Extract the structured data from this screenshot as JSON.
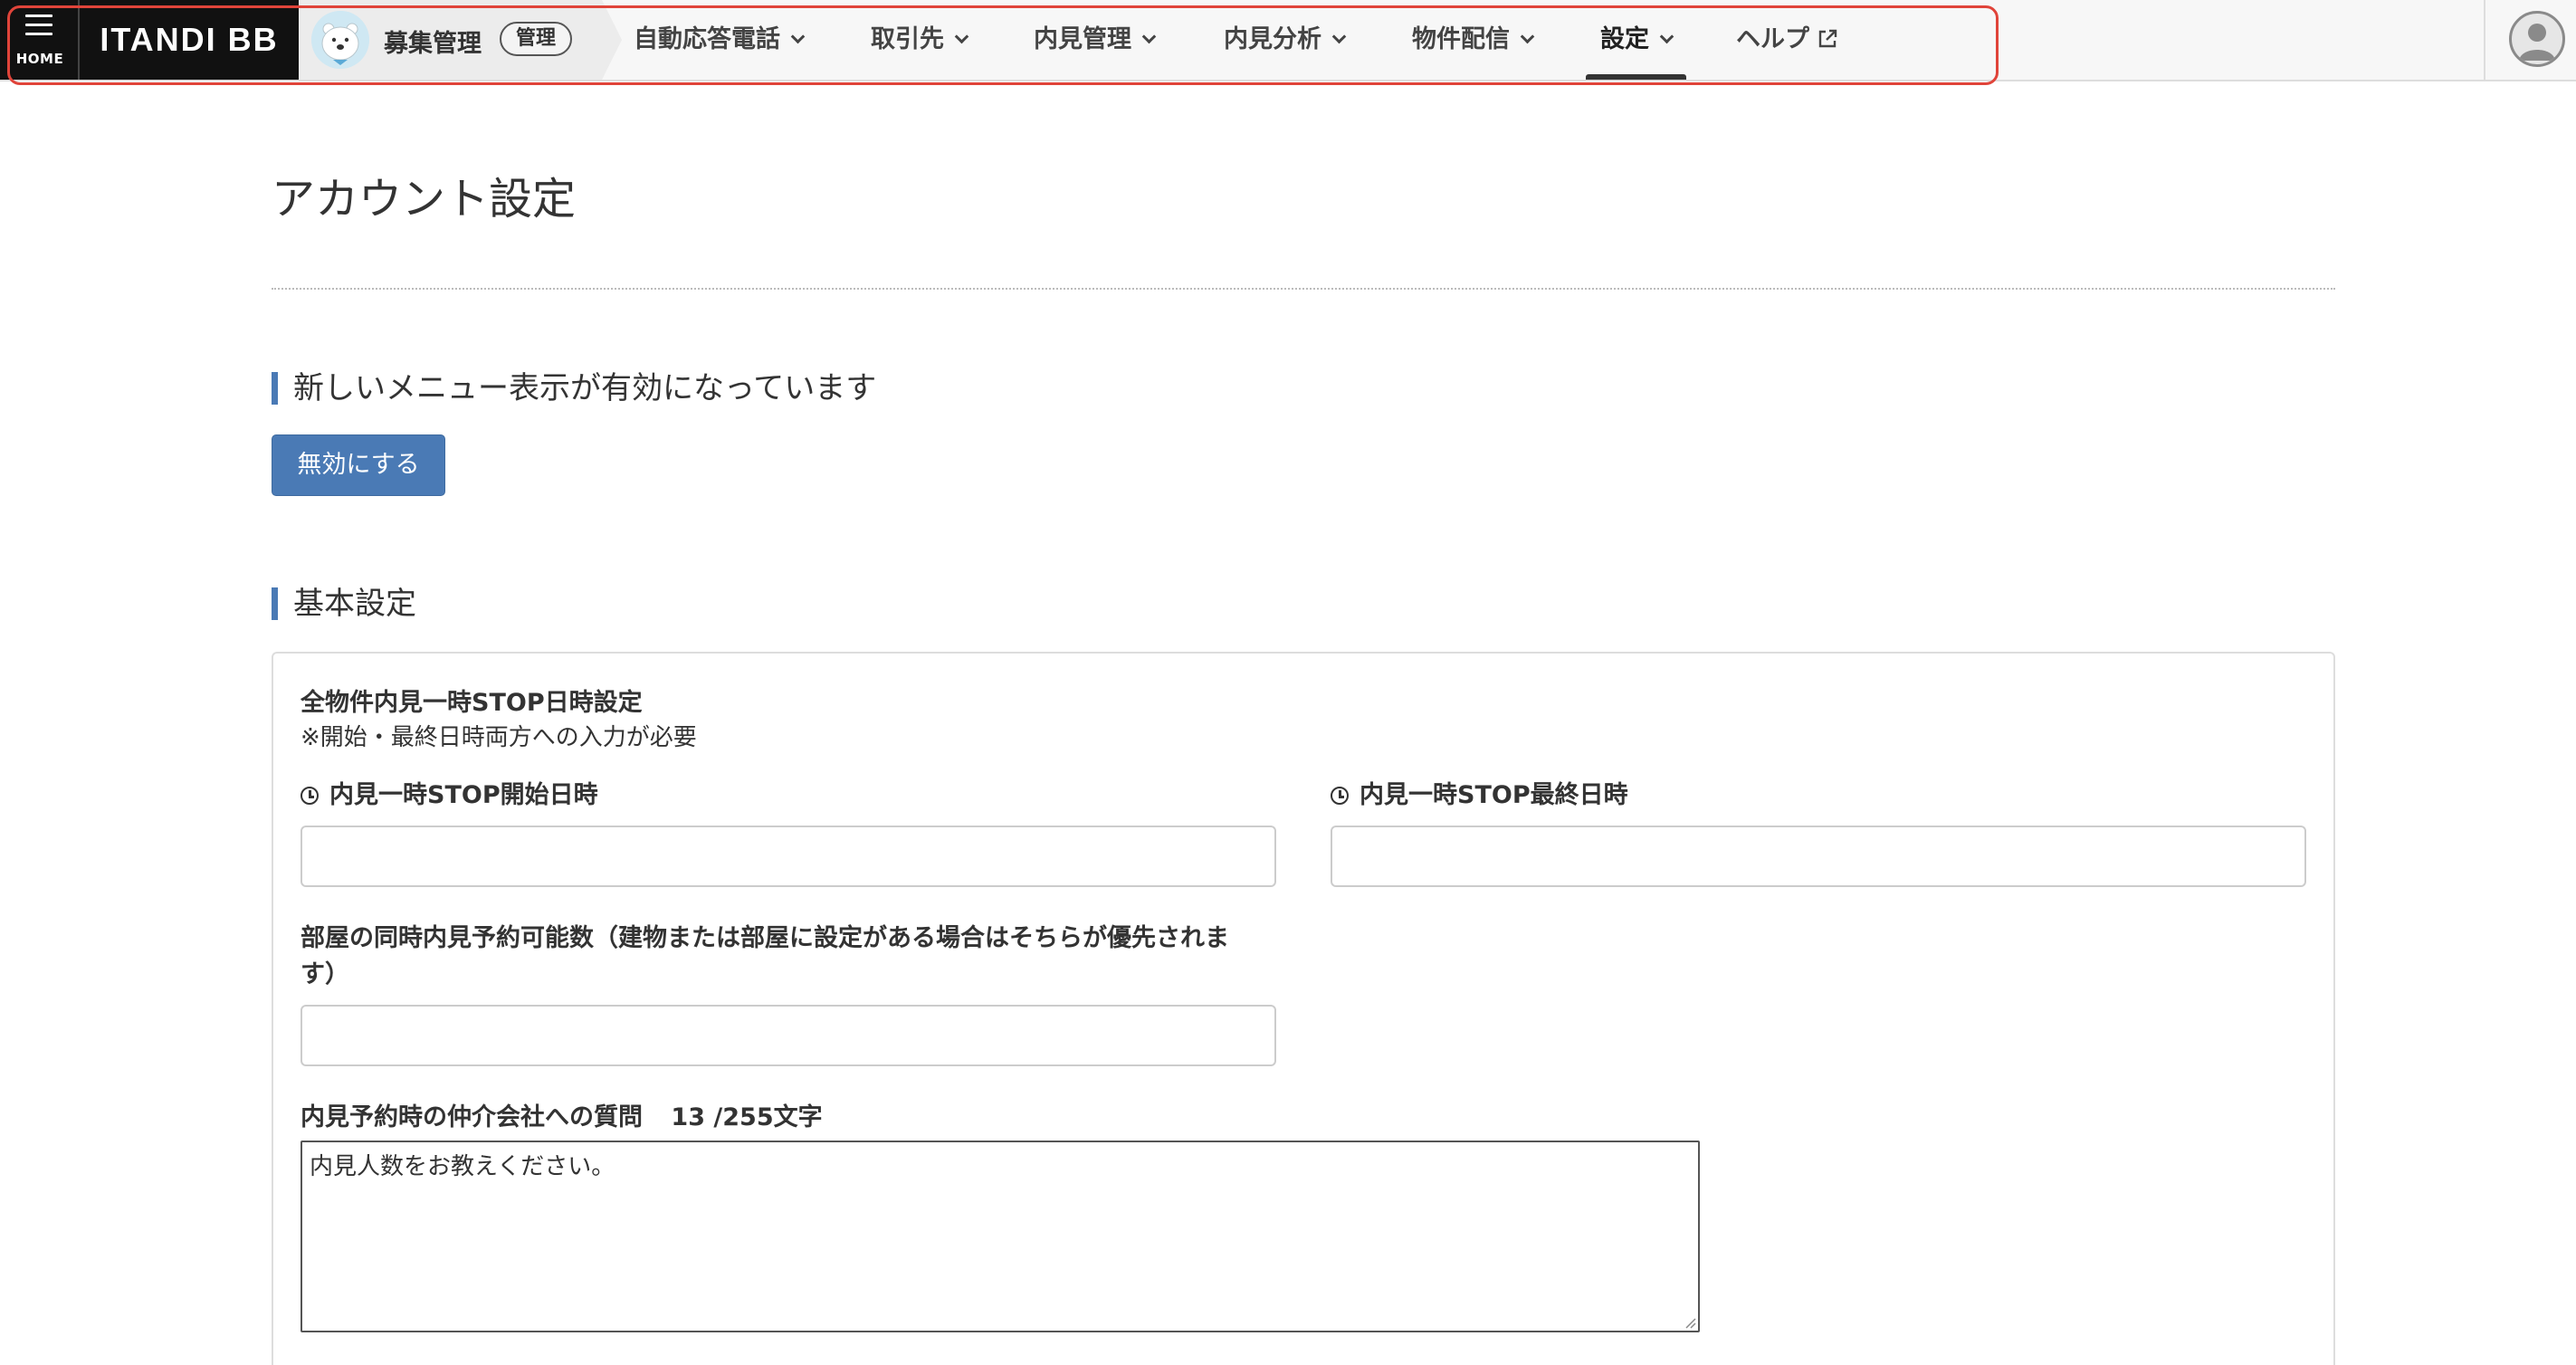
{
  "header": {
    "home_label": "HOME",
    "brand": "ITANDI BB",
    "product_name": "募集管理",
    "admin_badge": "管理",
    "nav": [
      {
        "label": "自動応答電話"
      },
      {
        "label": "取引先"
      },
      {
        "label": "内見管理"
      },
      {
        "label": "内見分析"
      },
      {
        "label": "物件配信"
      },
      {
        "label": "設定"
      },
      {
        "label": "ヘルプ"
      }
    ],
    "active_nav": "設定",
    "highlight_color": "#e0443a"
  },
  "page": {
    "title": "アカウント設定"
  },
  "menu_section": {
    "heading": "新しいメニュー表示が有効になっています",
    "button_label": "無効にする"
  },
  "basic_section": {
    "heading": "基本設定",
    "stop_title": "全物件内見一時STOP日時設定",
    "stop_note": "※開始・最終日時両方への入力が必要",
    "start_label": "内見一時STOP開始日時",
    "start_value": "",
    "end_label": "内見一時STOP最終日時",
    "end_value": "",
    "concurrent_label_line1": "部屋の同時内見予約可能数（建物または部屋に設定がある場合はそちらが優先されま",
    "concurrent_label_line2": "す）",
    "concurrent_value": "",
    "question_label": "内見予約時の仲介会社への質問",
    "question_count": "13 /255文字",
    "question_value": "内見人数をお教えください。"
  },
  "colors": {
    "accent": "#4a7ab5",
    "nav_bg": "#f7f7f7",
    "brand_bg": "#111111"
  }
}
